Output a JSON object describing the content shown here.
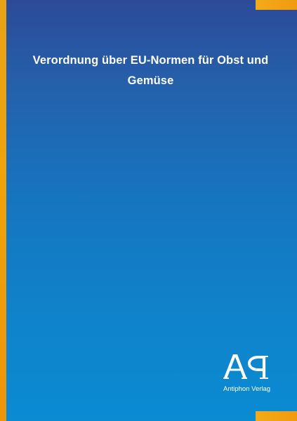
{
  "book": {
    "title": "Verordnung über EU-Normen für Obst und Gemüse",
    "publisher": "Antiphon Verlag",
    "logo_text": "AP"
  },
  "colors": {
    "background_top": "#2c4a97",
    "background_bottom": "#0a8bd2",
    "accent": "#f0a30a",
    "text": "#ffffff"
  }
}
